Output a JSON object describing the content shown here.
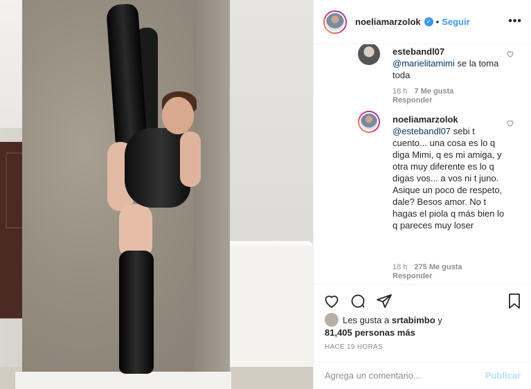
{
  "header": {
    "username": "noeliamarzolok",
    "separator": "•",
    "follow_label": "Seguir",
    "more_label": "•••"
  },
  "comments": [
    {
      "author": "estebandl07",
      "mention": "@marielitamimi",
      "text": " se la toma toda",
      "time": "18 h",
      "likes": "7 Me gusta",
      "reply": "Responder"
    },
    {
      "author": "noeliamarzolok",
      "mention": "@estebandl07",
      "text": " sebi t cuento... una cosa es lo q diga Mimi, q es mi amiga, y otra muy diferente es lo q digas vos... a vos ni t juno. Asique un poco de respeto, dale? Besos amor. No t hagas el piola q más bien lo q pareces muy loser",
      "time": "18 h",
      "likes": "275 Me gusta",
      "reply": "Responder"
    }
  ],
  "likes": {
    "prefix": "Les gusta a ",
    "user": "srtabimbo",
    "joiner": " y",
    "count": "81,405 personas más"
  },
  "time_ago": "HACE 19 HORAS",
  "add_comment": {
    "placeholder": "Agrega un comentario...",
    "publish_label": "Publicar"
  },
  "colors": {
    "accent": "#3897f0",
    "publish_disabled": "#b2dffc"
  }
}
